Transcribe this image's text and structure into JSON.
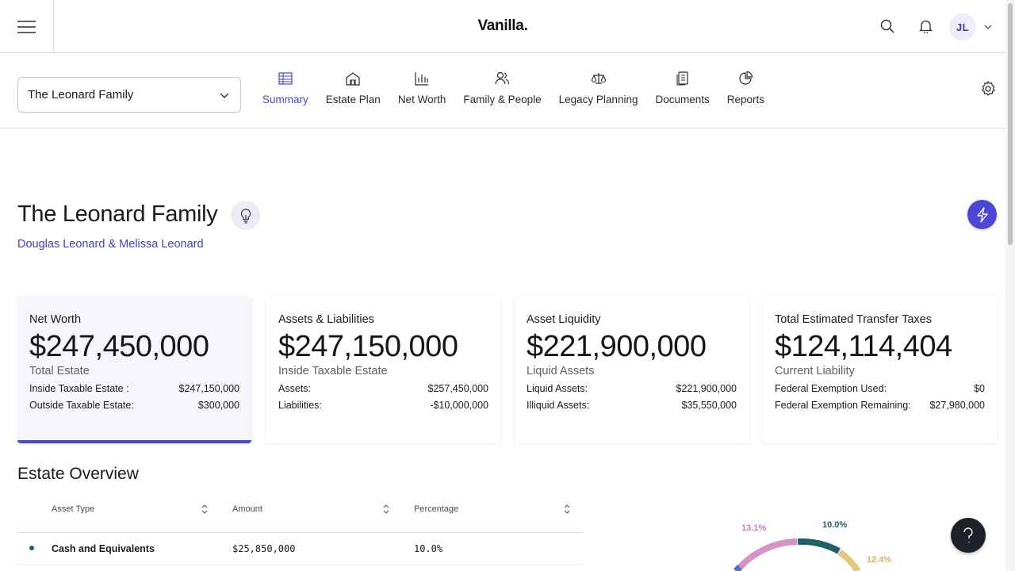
{
  "app": {
    "brand": "Vanilla",
    "brand_dot": "."
  },
  "user": {
    "initials": "JL"
  },
  "family_select": {
    "value": "The Leonard Family"
  },
  "tabs": [
    {
      "label": "Summary",
      "icon": "table-icon",
      "active": true
    },
    {
      "label": "Estate Plan",
      "icon": "house-icon"
    },
    {
      "label": "Net Worth",
      "icon": "bar-chart-icon"
    },
    {
      "label": "Family & People",
      "icon": "people-icon"
    },
    {
      "label": "Legacy Planning",
      "icon": "scale-icon"
    },
    {
      "label": "Documents",
      "icon": "document-icon"
    },
    {
      "label": "Reports",
      "icon": "pie-chart-icon"
    }
  ],
  "header": {
    "title": "The Leonard Family",
    "subtitle": "Douglas Leonard & Melissa Leonard"
  },
  "cards": [
    {
      "title": "Net Worth",
      "value": "$247,450,000",
      "sub": "Total Estate",
      "rows": [
        {
          "label": "Inside Taxable Estate :",
          "value": "$247,150,000"
        },
        {
          "label": "Outside Taxable Estate:",
          "value": "$300,000"
        }
      ]
    },
    {
      "title": "Assets & Liabilities",
      "value": "$247,150,000",
      "sub": "Inside Taxable Estate",
      "rows": [
        {
          "label": "Assets:",
          "value": "$257,450,000"
        },
        {
          "label": "Liabilities:",
          "value": "-$10,000,000"
        }
      ]
    },
    {
      "title": "Asset Liquidity",
      "value": "$221,900,000",
      "sub": "Liquid Assets",
      "rows": [
        {
          "label": "Liquid Assets:",
          "value": "$221,900,000"
        },
        {
          "label": "Illiquid Assets:",
          "value": "$35,550,000"
        }
      ]
    },
    {
      "title": "Total Estimated Transfer Taxes",
      "value": "$124,114,404",
      "sub": "Current Liability",
      "rows": [
        {
          "label": "Federal Exemption Used:",
          "value": "$0"
        },
        {
          "label": "Federal Exemption Remaining:",
          "value": "$27,980,000"
        }
      ]
    }
  ],
  "overview": {
    "title": "Estate Overview",
    "columns": [
      "Asset Type",
      "Amount",
      "Percentage"
    ],
    "rows": [
      {
        "type": "Cash and Equivalents",
        "amount": "$25,850,000",
        "percentage": "10.0%"
      }
    ]
  },
  "donut": {
    "labels": [
      {
        "text": "13.1%",
        "color": "#c77cb8"
      },
      {
        "text": "10.0%",
        "color": "#1f5f66"
      },
      {
        "text": "12.4%",
        "color": "#e0c26e"
      }
    ]
  },
  "colors": {
    "accent": "#4b46d6",
    "link": "#4441b8"
  }
}
